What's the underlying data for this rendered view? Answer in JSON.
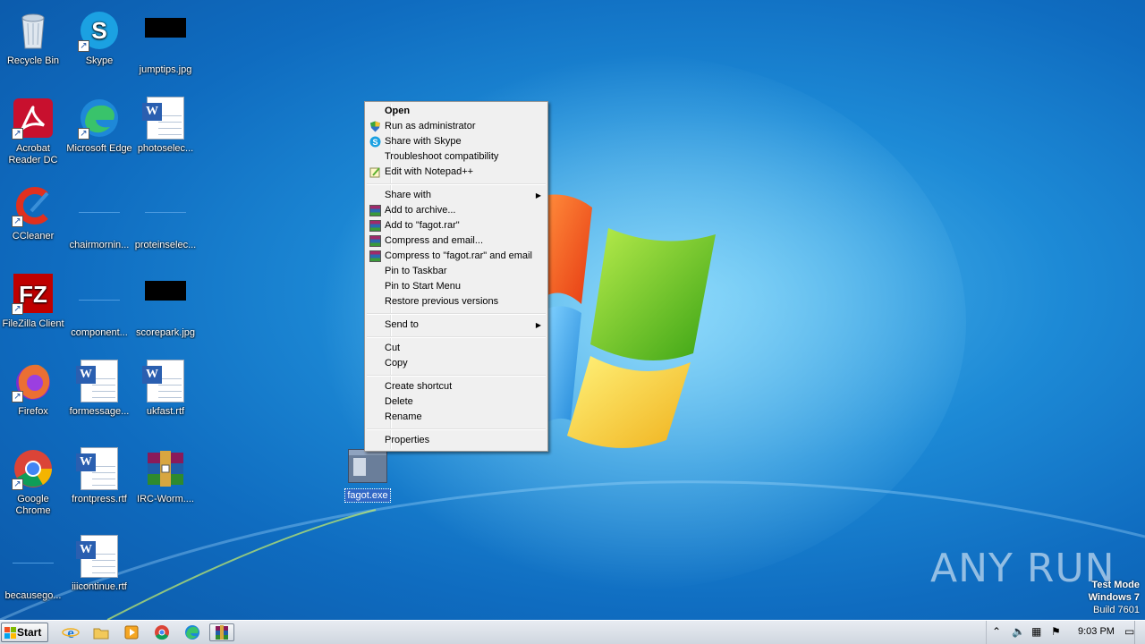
{
  "desktop": {
    "icons": [
      {
        "label": "Recycle Bin"
      },
      {
        "label": "Skype"
      },
      {
        "label": "jumptips.jpg"
      },
      {
        "label": "Acrobat Reader DC"
      },
      {
        "label": "Microsoft Edge"
      },
      {
        "label": "photoselec..."
      },
      {
        "label": "CCleaner"
      },
      {
        "label": "chairmornin..."
      },
      {
        "label": "proteinselec..."
      },
      {
        "label": "FileZilla Client"
      },
      {
        "label": "component..."
      },
      {
        "label": "scorepark.jpg"
      },
      {
        "label": "Firefox"
      },
      {
        "label": "formessage..."
      },
      {
        "label": "ukfast.rtf"
      },
      {
        "label": "Google Chrome"
      },
      {
        "label": "frontpress.rtf"
      },
      {
        "label": "IRC-Worm...."
      },
      {
        "label": "becausego..."
      },
      {
        "label": "iiicontinue.rtf"
      }
    ],
    "selected_file": {
      "label": "fagot.exe"
    }
  },
  "context_menu": {
    "items": [
      {
        "label": "Open",
        "icon": "none"
      },
      {
        "label": "Run as administrator",
        "icon": "uac-shield-icon"
      },
      {
        "label": "Share with Skype",
        "icon": "skype-icon"
      },
      {
        "label": "Troubleshoot compatibility",
        "icon": "none"
      },
      {
        "label": "Edit with Notepad++",
        "icon": "notepad-plus-plus-icon"
      },
      {
        "label": "Share with",
        "icon": "none"
      },
      {
        "label": "Add to archive...",
        "icon": "winrar-icon"
      },
      {
        "label": "Add to \"fagot.rar\"",
        "icon": "winrar-icon"
      },
      {
        "label": "Compress and email...",
        "icon": "winrar-icon"
      },
      {
        "label": "Compress to \"fagot.rar\" and email",
        "icon": "winrar-icon"
      },
      {
        "label": "Pin to Taskbar",
        "icon": "none"
      },
      {
        "label": "Pin to Start Menu",
        "icon": "none"
      },
      {
        "label": "Restore previous versions",
        "icon": "none"
      },
      {
        "label": "Send to",
        "icon": "none"
      },
      {
        "label": "Cut",
        "icon": "none"
      },
      {
        "label": "Copy",
        "icon": "none"
      },
      {
        "label": "Create shortcut",
        "icon": "none"
      },
      {
        "label": "Delete",
        "icon": "none"
      },
      {
        "label": "Rename",
        "icon": "none"
      },
      {
        "label": "Properties",
        "icon": "none"
      }
    ]
  },
  "watermark": {
    "brand": "ANY RUN",
    "test_mode": "Test Mode",
    "os": "Windows 7",
    "build": "Build 7601"
  },
  "taskbar": {
    "start_label": "Start",
    "pinned": [
      "internet-explorer-icon",
      "file-explorer-icon",
      "media-player-icon",
      "chrome-icon",
      "edge-icon",
      "winrar-icon"
    ],
    "clock": "9:03 PM"
  },
  "colors": {
    "desktop_blue": "#1d8ad6",
    "menu_bg": "#f0f0f0",
    "selection": "#3168c6"
  }
}
